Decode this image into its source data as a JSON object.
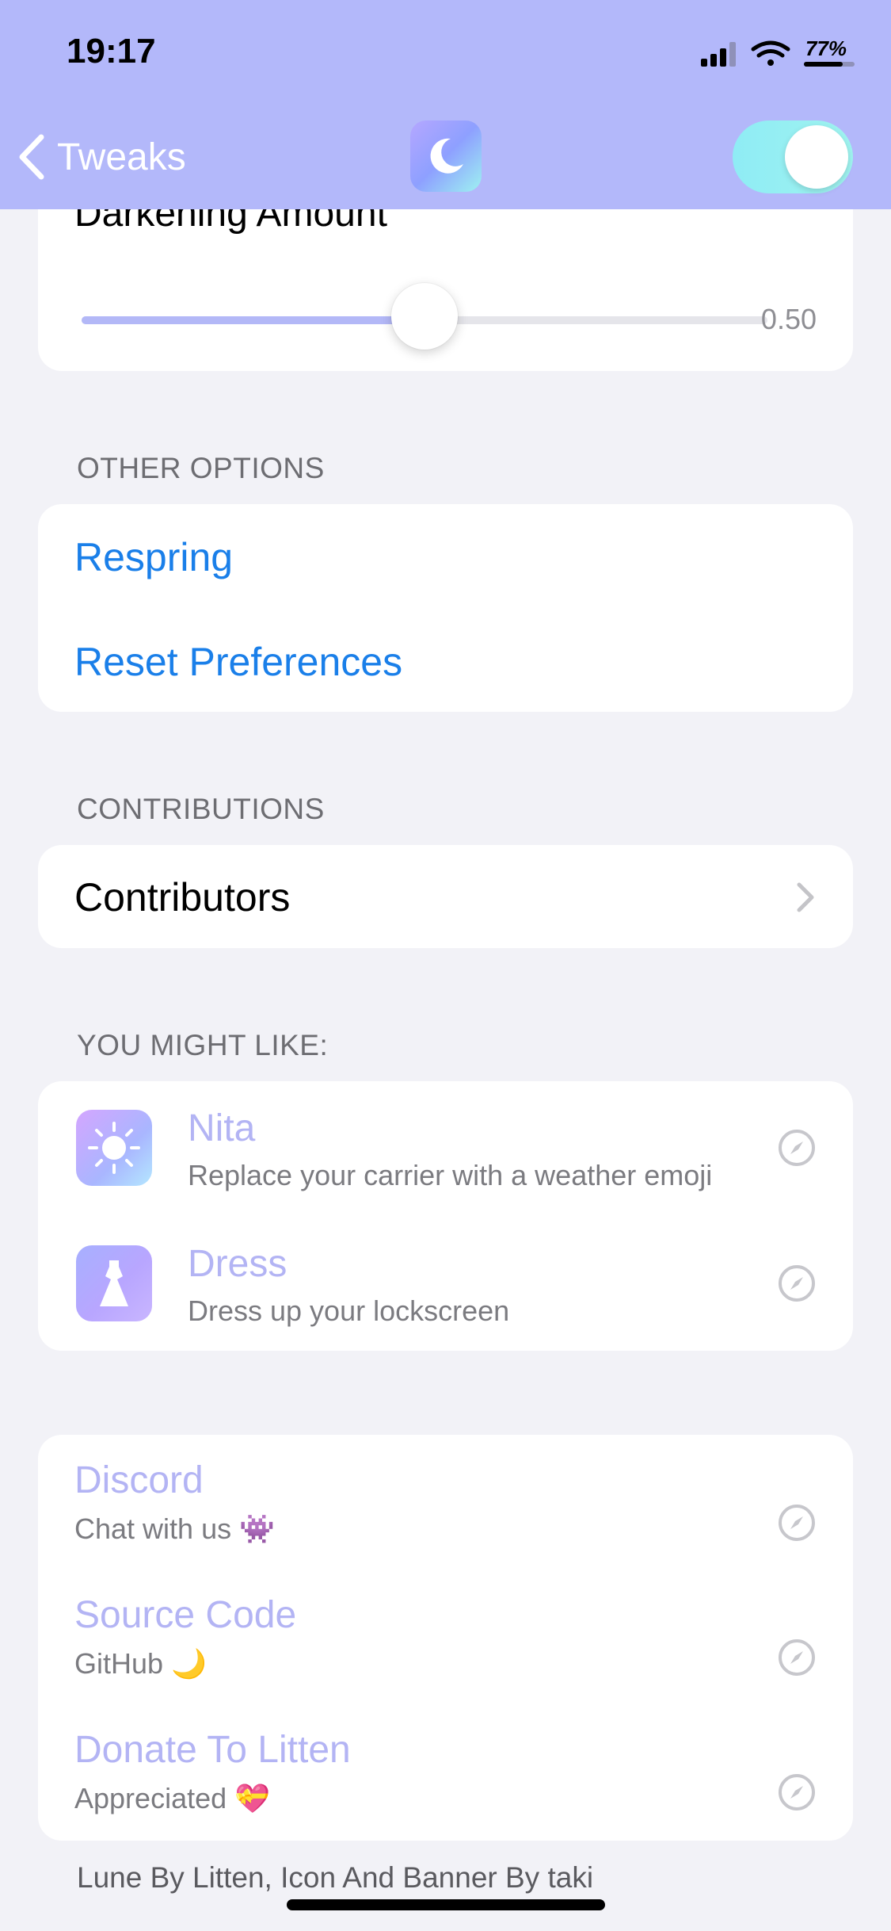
{
  "status_bar": {
    "time": "19:17",
    "battery": "77%"
  },
  "nav": {
    "back_label": "Tweaks",
    "app_icon": "moon-icon",
    "enabled": true
  },
  "slider": {
    "title": "Darkening Amount",
    "value": 0.5,
    "value_label": "0.50"
  },
  "other_options": {
    "header": "OTHER OPTIONS",
    "items": [
      {
        "label": "Respring"
      },
      {
        "label": "Reset Preferences"
      }
    ]
  },
  "contributions": {
    "header": "CONTRIBUTIONS",
    "items": [
      {
        "label": "Contributors"
      }
    ]
  },
  "you_might_like": {
    "header": "YOU MIGHT LIKE:",
    "items": [
      {
        "title": "Nita",
        "subtitle": "Replace your carrier with a weather emoji",
        "icon": "sun-icon"
      },
      {
        "title": "Dress",
        "subtitle": "Dress up your lockscreen",
        "icon": "dress-icon"
      }
    ]
  },
  "links": [
    {
      "title": "Discord",
      "subtitle": "Chat with us 👾"
    },
    {
      "title": "Source Code",
      "subtitle": "GitHub 🌙"
    },
    {
      "title": "Donate To Litten",
      "subtitle": "Appreciated 💝"
    }
  ],
  "footer": "Lune By Litten, Icon And Banner By taki",
  "colors": {
    "header_bg": "#b3b8fa",
    "accent_link": "#1a7fe9",
    "lavender_text": "#b3b4f4",
    "toggle_on": "#9ff3ef"
  }
}
